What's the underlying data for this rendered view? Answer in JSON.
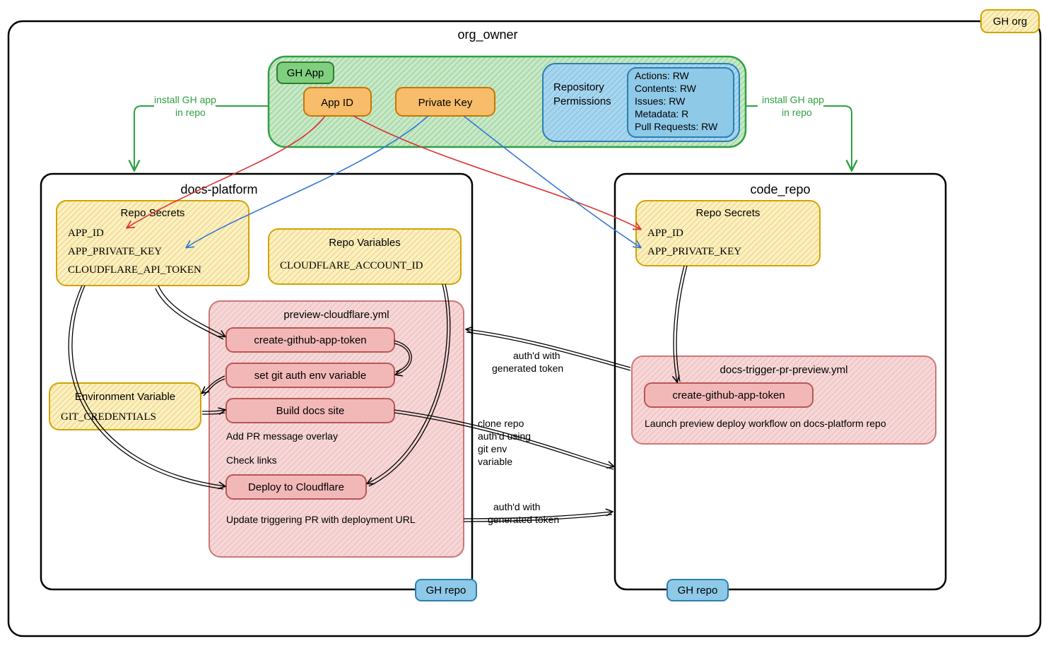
{
  "org": {
    "badge": "GH org",
    "title": "org_owner"
  },
  "app": {
    "badge": "GH App",
    "app_id": "App ID",
    "private_key": "Private Key",
    "repo_perms_title": "Repository\nPermissions",
    "perms": {
      "p1": "Actions: RW",
      "p2": "Contents: RW",
      "p3": "Issues: RW",
      "p4": "Metadata: R",
      "p5": "Pull Requests: RW"
    }
  },
  "install": {
    "left1": "install GH app",
    "left2": "in repo",
    "right1": "install GH app",
    "right2": "in repo"
  },
  "docs": {
    "title": "docs-platform",
    "secrets": {
      "title": "Repo Secrets",
      "s1": "APP_ID",
      "s2": "APP_PRIVATE_KEY",
      "s3": "CLOUDFLARE_API_TOKEN"
    },
    "vars": {
      "title": "Repo Variables",
      "v1": "CLOUDFLARE_ACCOUNT_ID"
    },
    "env": {
      "title": "Environment Variable",
      "v1": "GIT_CREDENTIALS"
    },
    "wf": {
      "title": "preview-cloudflare.yml",
      "step1": "create-github-app-token",
      "step2": "set git auth env variable",
      "step3": "Build docs site",
      "note1": "Add PR message overlay",
      "note2": "Check links",
      "step4": "Deploy to Cloudflare",
      "note3": "Update triggering PR with deployment URL"
    },
    "repo_badge": "GH repo"
  },
  "code": {
    "title": "code_repo",
    "secrets": {
      "title": "Repo Secrets",
      "s1": "APP_ID",
      "s2": "APP_PRIVATE_KEY"
    },
    "wf": {
      "title": "docs-trigger-pr-preview.yml",
      "step1": "create-github-app-token",
      "note1": "Launch preview deploy workflow on docs-platform repo"
    },
    "repo_badge": "GH repo"
  },
  "flows": {
    "f1a": "auth'd with",
    "f1b": "generated token",
    "f2a": "clone repo",
    "f2b": "auth'd using",
    "f2c": "git env",
    "f2d": "variable",
    "f3a": "auth'd with",
    "f3b": "generated token"
  },
  "colors": {
    "border": "#000",
    "yellow_fill": "#fdf0c0",
    "yellow_stroke": "#d1a400",
    "green_fill": "#b8e3b8",
    "green_dark": "#2ea043",
    "orange_fill": "#f7bd6a",
    "orange_stroke": "#c77700",
    "blue_fill": "#8fc9e8",
    "blue_stroke": "#2b7fb0",
    "pink_fill": "#f7d7d7",
    "pink_stroke": "#c77",
    "pink_step_fill": "#f2b8b8",
    "pink_step_stroke": "#b55",
    "red_line": "#d33",
    "blue_line": "#3478d4"
  }
}
